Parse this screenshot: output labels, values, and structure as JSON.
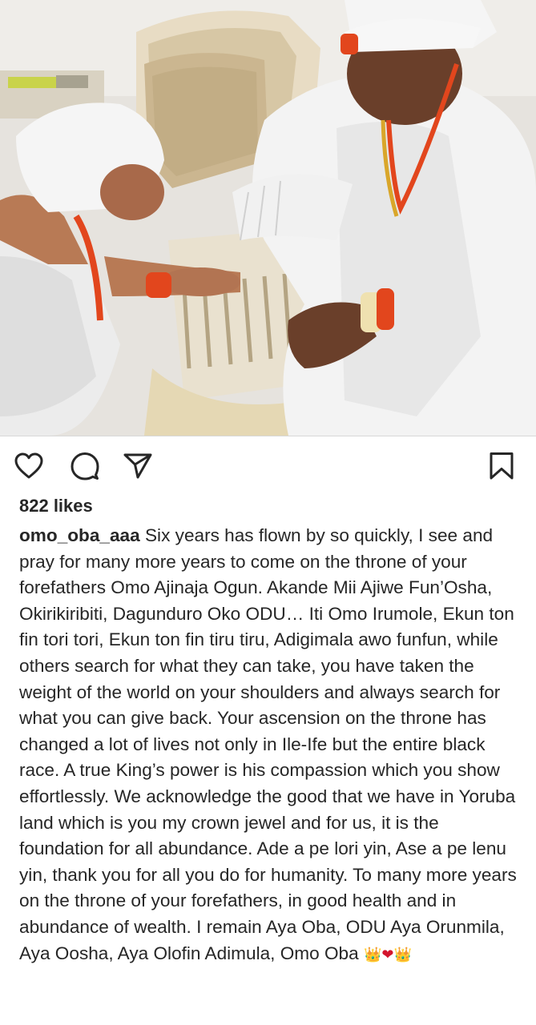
{
  "post": {
    "photo_alt": "Woman in white kneeling beside a seated man in white royal attire",
    "actions": {
      "like_icon": "heart-outline-icon",
      "comment_icon": "comment-bubble-icon",
      "share_icon": "paper-plane-icon",
      "save_icon": "bookmark-outline-icon"
    },
    "likes_text": "822 likes",
    "username": "omo_oba_aaa",
    "caption_text": " Six years has flown by so quickly, I see and pray for many more years to come on the throne of your forefathers Omo Ajinaja Ogun. Akande Mii Ajiwe Fun’Osha, Okirikiribiti, Dagunduro Oko ODU… Iti Omo Irumole, Ekun ton fin tori tori, Ekun ton fin tiru tiru, Adigimala awo funfun, while others search for what they can take, you have taken the weight of the world on your shoulders and always search for what you can give back. Your ascension on the throne has changed a lot of lives not only in Ile-Ife but the entire black race. A true King’s power is his compassion which you show effortlessly. We acknowledge the good that we have in Yoruba land which is you my crown jewel and for us, it is the foundation for all abundance. Ade a pe lori yin, Ase a pe lenu yin, thank you for all you do for humanity. To many more years on the throne of your forefathers, in good health and in abundance of wealth. I remain Aya Oba, ODU Aya Orunmila, Aya Oosha, Aya Olofin Adimula, Omo Oba ",
    "caption_emojis": [
      "👑",
      "❤",
      "👑"
    ]
  },
  "colors": {
    "text": "#262626",
    "divider": "#d8d8d8",
    "attire_white": "#f2f2f2",
    "coral_beads": "#e2461d",
    "gold": "#d9a62a"
  }
}
